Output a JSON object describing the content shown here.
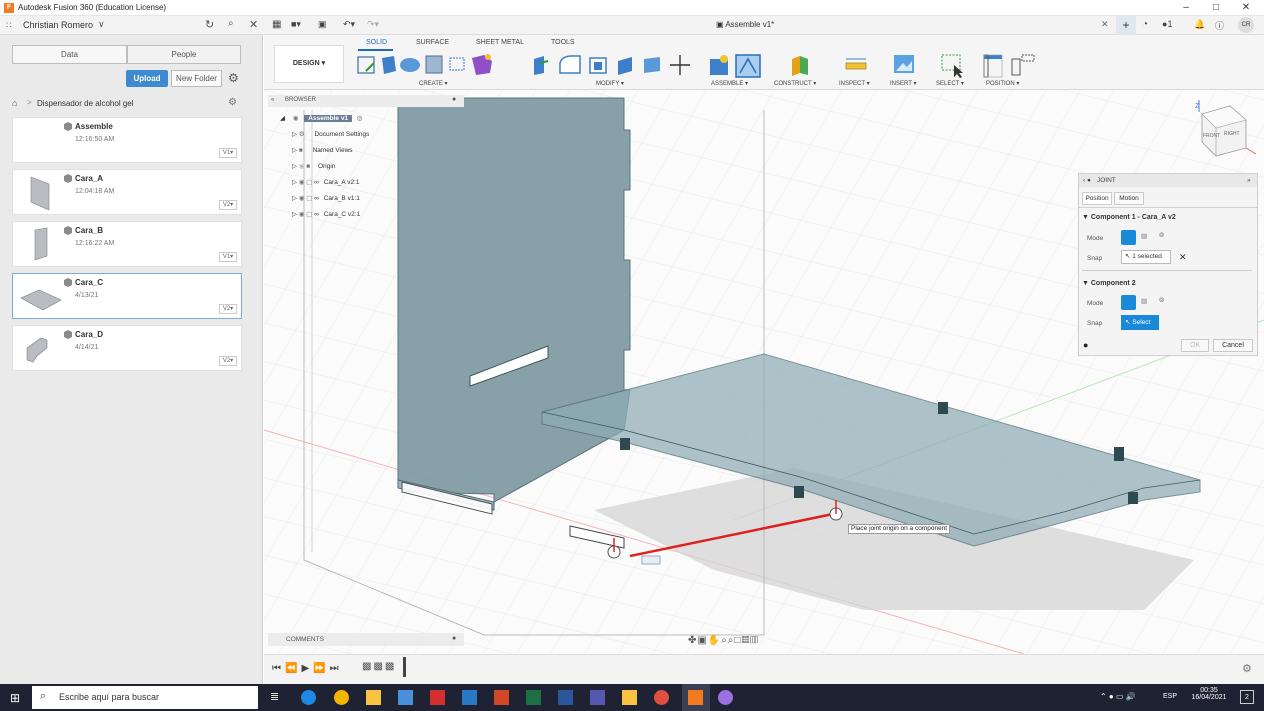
{
  "window": {
    "title": "Autodesk Fusion 360 (Education License)",
    "minimize": "–",
    "maximize": "□",
    "close": "✕"
  },
  "appbar": {
    "user": "Christian Romero",
    "doc_tab": "Assemble v1*",
    "online_count": "1",
    "initials": "CR"
  },
  "data_panel": {
    "tab_data": "Data",
    "tab_people": "People",
    "upload": "Upload",
    "new_folder": "New Folder",
    "breadcrumb": "Dispensador de alcohol gel",
    "items": [
      {
        "name": "Assemble",
        "date": "12:16:50 AM",
        "version": "V1▾"
      },
      {
        "name": "Cara_A",
        "date": "12:04:18 AM",
        "version": "V2▾"
      },
      {
        "name": "Cara_B",
        "date": "12:16:22 AM",
        "version": "V1▾"
      },
      {
        "name": "Cara_C",
        "date": "4/13/21",
        "version": "V2▾"
      },
      {
        "name": "Cara_D",
        "date": "4/14/21",
        "version": "V2▾"
      }
    ]
  },
  "ribbon": {
    "workspace": "DESIGN ▾",
    "tabs": [
      "SOLID",
      "SURFACE",
      "SHEET METAL",
      "TOOLS"
    ],
    "groups": [
      "CREATE ▾",
      "MODIFY ▾",
      "ASSEMBLE ▾",
      "CONSTRUCT ▾",
      "INSPECT ▾",
      "INSERT ▾",
      "SELECT ▾",
      "POSITION ▾"
    ]
  },
  "browser": {
    "header": "BROWSER",
    "root": "Assemble v1",
    "rows": [
      "Document Settings",
      "Named Views",
      "Origin",
      "Cara_A v2:1",
      "Cara_B v1:1",
      "Cara_C v2:1"
    ]
  },
  "viewcube": {
    "front": "FRONT",
    "right": "RIGHT",
    "z": "Z"
  },
  "tooltip": "Place joint origin on a component",
  "joint": {
    "title": "JOINT",
    "tab_position": "Position",
    "tab_motion": "Motion",
    "component1": "▼ Component 1 - Cara_A v2",
    "component2": "▼ Component 2",
    "mode_label": "Mode",
    "snap_label": "Snap",
    "snap1": "1 selected",
    "snap2": "Select",
    "ok": "OK",
    "cancel": "Cancel"
  },
  "comments": "COMMENTS",
  "taskbar": {
    "search": "Escribe aquí para buscar",
    "lang": "ESP",
    "time": "00:35",
    "date": "16/04/2021",
    "notif": "2"
  },
  "colors": {
    "accent": "#1a8ad8",
    "fusion_orange": "#f47a20",
    "red_line": "#e02020",
    "solid_fill": "#6f8d96"
  }
}
